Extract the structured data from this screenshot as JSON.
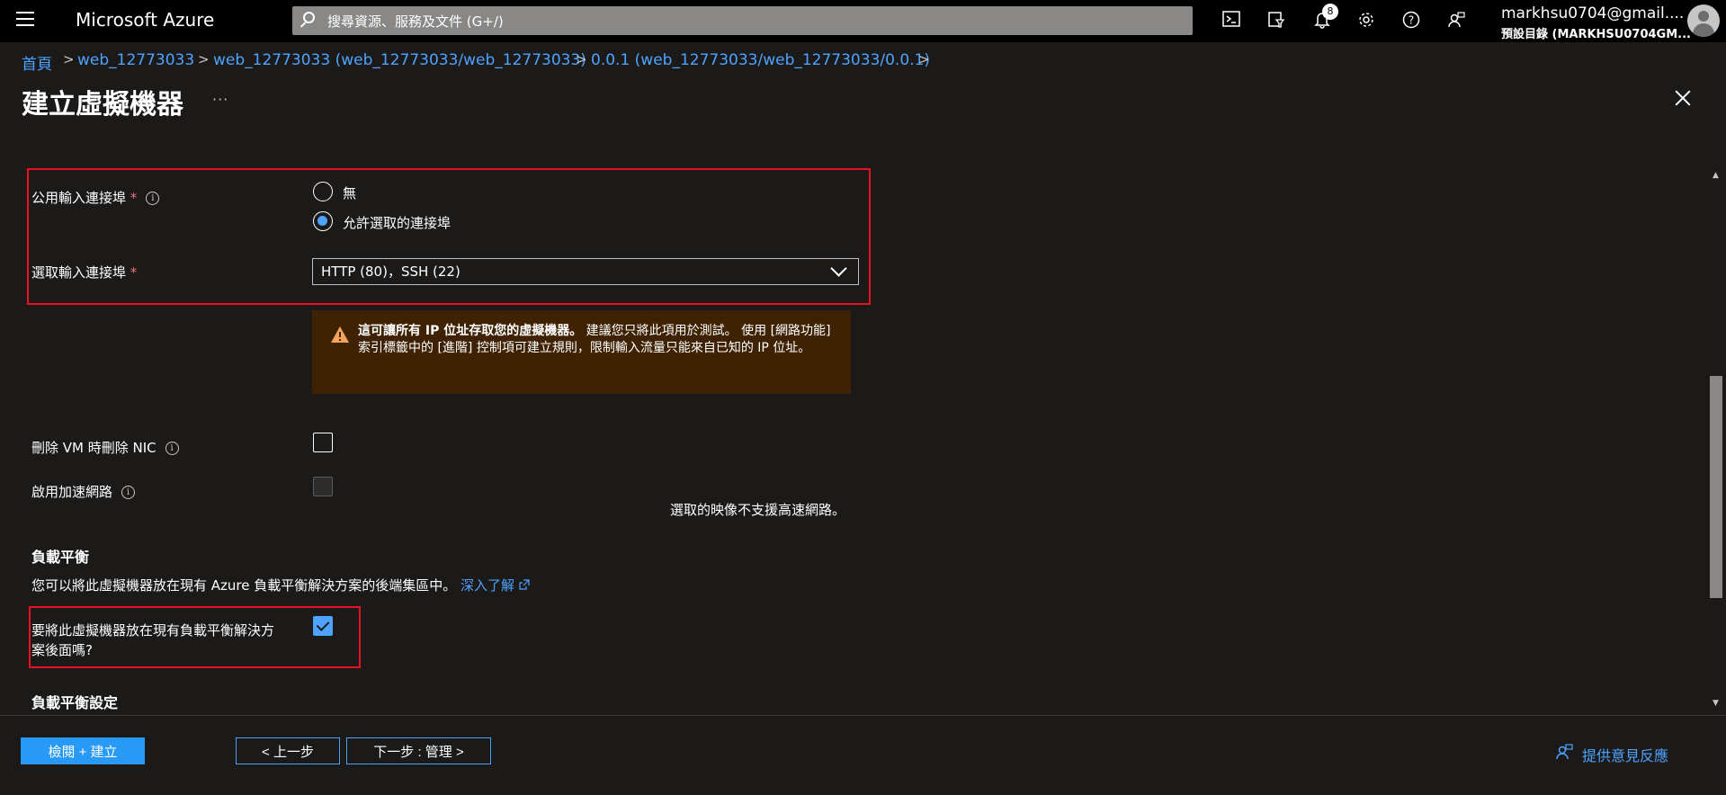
{
  "topbar": {
    "brand": "Microsoft Azure",
    "search_placeholder": "搜尋資源、服務及文件 (G+/)",
    "notification_count": "8",
    "user_name": "markhsu0704@gmail....",
    "user_directory": "預設目錄 (MARKHSU0704GM..."
  },
  "breadcrumb": {
    "items": [
      "首頁",
      "web_12773033",
      "web_12773033 (web_12773033/web_12773033)",
      "0.0.1 (web_12773033/web_12773033/0.0.1)"
    ],
    "separator": ">"
  },
  "page": {
    "title": "建立虛擬機器",
    "more": "···"
  },
  "form": {
    "public_ports_label": "公用輸入連接埠",
    "required_mark": "*",
    "radio_none": "無",
    "radio_allow": "允許選取的連接埠",
    "select_ports_label": "選取輸入連接埠",
    "select_ports_value": "HTTP (80)，SSH (22)",
    "warning_bold": "這可讓所有 IP 位址存取您的虛擬機器。",
    "warning_text": " 建議您只將此項用於測試。 使用 [網路功能] 索引標籤中的 [進階] 控制項可建立規則，限制輸入流量只能來自已知的 IP 位址。",
    "delete_nic_label": "刪除 VM 時刪除 NIC",
    "accel_net_label": "啟用加速網路",
    "accel_net_note": "選取的映像不支援高速網路。",
    "lb_heading": "負載平衡",
    "lb_desc": "您可以將此虛擬機器放在現有 Azure 負載平衡解決方案的後端集區中。",
    "lb_learn_more": "深入了解",
    "lb_question_line1": "要將此虛擬機器放在現有負載平衡解決方",
    "lb_question_line2": "案後面嗎?",
    "lb_settings_heading": "負載平衡設定"
  },
  "footer": {
    "review_create": "檢閱 + 建立",
    "prev": "< 上一步",
    "next": "下一步 : 管理 >",
    "feedback": "提供意見反應"
  },
  "colors": {
    "accent": "#2899f5",
    "link": "#4da3ff",
    "highlight_border": "#e81123",
    "warning_bg": "#3f2203"
  }
}
